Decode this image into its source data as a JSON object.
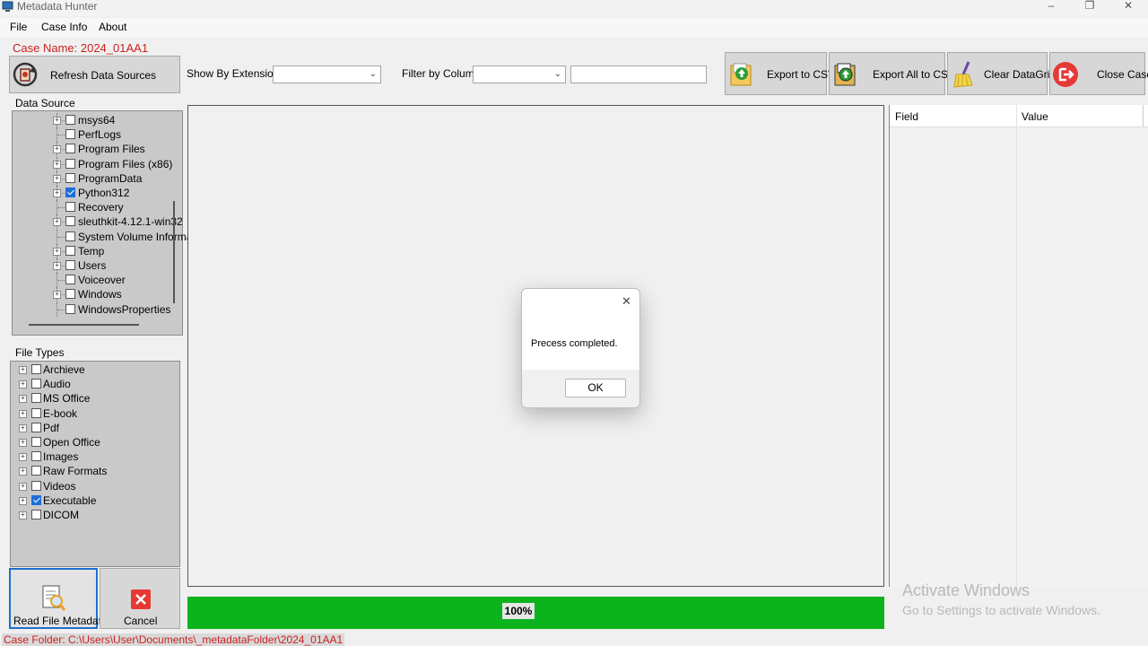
{
  "window": {
    "title": "Metadata Hunter",
    "minimize": "–",
    "maximize": "❐",
    "close": "✕"
  },
  "menu": [
    "File",
    "Case Info",
    "About"
  ],
  "case_name": "Case Name: 2024_01AA1",
  "toolbar": {
    "refresh_label": "Refresh Data Sources",
    "show_by_extension_label": "Show By Extension",
    "show_by_extension_value": "",
    "filter_by_column_label": "Filter by Column",
    "filter_by_column_value": "",
    "filter_text_value": "",
    "export_csv_label": "Export to CSV",
    "export_all_label": "Export All to CSV",
    "clear_grid_label": "Clear DataGrid",
    "close_case_label": "Close Case"
  },
  "data_source": {
    "label": "Data Source",
    "items": [
      {
        "label": "msys64",
        "expandable": true,
        "checked": false
      },
      {
        "label": "PerfLogs",
        "expandable": false,
        "checked": false
      },
      {
        "label": "Program Files",
        "expandable": true,
        "checked": false
      },
      {
        "label": "Program Files (x86)",
        "expandable": true,
        "checked": false
      },
      {
        "label": "ProgramData",
        "expandable": true,
        "checked": false
      },
      {
        "label": "Python312",
        "expandable": true,
        "checked": true
      },
      {
        "label": "Recovery",
        "expandable": false,
        "checked": false
      },
      {
        "label": "sleuthkit-4.12.1-win32",
        "expandable": true,
        "checked": false
      },
      {
        "label": "System Volume Informa",
        "expandable": false,
        "checked": false
      },
      {
        "label": "Temp",
        "expandable": true,
        "checked": false
      },
      {
        "label": "Users",
        "expandable": true,
        "checked": false
      },
      {
        "label": "Voiceover",
        "expandable": false,
        "checked": false
      },
      {
        "label": "Windows",
        "expandable": true,
        "checked": false
      },
      {
        "label": "WindowsProperties",
        "expandable": false,
        "checked": false
      }
    ]
  },
  "file_types": {
    "label": "File Types",
    "items": [
      {
        "label": "Archieve",
        "checked": false
      },
      {
        "label": "Audio",
        "checked": false
      },
      {
        "label": "MS Office",
        "checked": false
      },
      {
        "label": "E-book",
        "checked": false
      },
      {
        "label": "Pdf",
        "checked": false
      },
      {
        "label": "Open Office",
        "checked": false
      },
      {
        "label": "Images",
        "checked": false
      },
      {
        "label": "Raw Formats",
        "checked": false
      },
      {
        "label": "Videos",
        "checked": false
      },
      {
        "label": "Executable",
        "checked": true
      },
      {
        "label": "DICOM",
        "checked": false
      }
    ]
  },
  "actions": {
    "read_label": "Read File Metadata",
    "cancel_label": "Cancel"
  },
  "properties": {
    "columns": [
      "Field",
      "Value"
    ]
  },
  "progress": {
    "value": 1.0,
    "text": "100%"
  },
  "status": {
    "text": "Case Folder: C:\\Users\\User\\Documents\\_metadataFolder\\2024_01AA1"
  },
  "dialog": {
    "message": "Precess completed.",
    "ok_label": "OK",
    "close": "✕"
  },
  "watermark": {
    "line1": "Activate Windows",
    "line2": "Go to Settings to activate Windows."
  },
  "colors": {
    "accent_red": "#cc1f1f",
    "progress_green": "#0bb31d",
    "check_blue": "#1e6fd9"
  }
}
